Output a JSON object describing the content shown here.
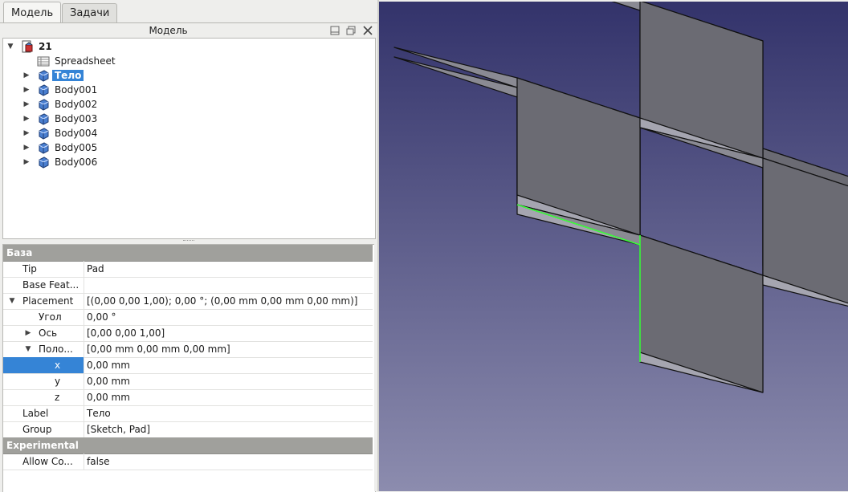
{
  "tabs": [
    {
      "label": "Модель",
      "active": true
    },
    {
      "label": "Задачи",
      "active": false
    }
  ],
  "tree_panel": {
    "title": "Модель",
    "items": [
      {
        "label": "21",
        "level": 0,
        "expanded": true,
        "icon": "document-icon",
        "bold": true
      },
      {
        "label": "Spreadsheet",
        "level": 1,
        "icon": "spreadsheet-icon"
      },
      {
        "label": "Тело",
        "level": 1,
        "icon": "body-icon",
        "selected": true,
        "collapsed": true
      },
      {
        "label": "Body001",
        "level": 1,
        "icon": "body-icon",
        "collapsed": true
      },
      {
        "label": "Body002",
        "level": 1,
        "icon": "body-icon",
        "collapsed": true
      },
      {
        "label": "Body003",
        "level": 1,
        "icon": "body-icon",
        "collapsed": true
      },
      {
        "label": "Body004",
        "level": 1,
        "icon": "body-icon",
        "collapsed": true
      },
      {
        "label": "Body005",
        "level": 1,
        "icon": "body-icon",
        "collapsed": true
      },
      {
        "label": "Body006",
        "level": 1,
        "icon": "body-icon",
        "collapsed": true
      }
    ]
  },
  "properties": {
    "rows": [
      {
        "type": "group",
        "name": "База"
      },
      {
        "type": "prop",
        "name": "Tip",
        "value": "Pad",
        "indent": 0
      },
      {
        "type": "prop",
        "name": "Base Feat...",
        "value": "",
        "indent": 0
      },
      {
        "type": "prop",
        "name": "Placement",
        "value": "[(0,00 0,00 1,00); 0,00 °; (0,00 mm  0,00 mm  0,00 mm)]",
        "indent": 0,
        "arrow": "down"
      },
      {
        "type": "prop",
        "name": "Угол",
        "value": "0,00 °",
        "indent": 1
      },
      {
        "type": "prop",
        "name": "Ось",
        "value": "[0,00 0,00 1,00]",
        "indent": 1,
        "arrow": "right"
      },
      {
        "type": "prop",
        "name": "Поло...",
        "value": "[0,00 mm  0,00 mm  0,00 mm]",
        "indent": 1,
        "arrow": "down"
      },
      {
        "type": "prop",
        "name": "x",
        "value": "0,00 mm",
        "indent": 2,
        "selected": true
      },
      {
        "type": "prop",
        "name": "y",
        "value": "0,00 mm",
        "indent": 2
      },
      {
        "type": "prop",
        "name": "z",
        "value": "0,00 mm",
        "indent": 2
      },
      {
        "type": "prop",
        "name": "Label",
        "value": "Тело",
        "indent": 0
      },
      {
        "type": "prop",
        "name": "Group",
        "value": "[Sketch, Pad]",
        "indent": 0
      },
      {
        "type": "group",
        "name": "Experimental"
      },
      {
        "type": "prop",
        "name": "Allow Co...",
        "value": "false",
        "indent": 0
      }
    ]
  },
  "view3d": {
    "background_top": "#33336b",
    "background_bottom": "#8c8cae",
    "face_top": "#8a8a93",
    "face_front": "#a5a5b0",
    "face_side": "#6b6b73",
    "edge_color": "#111111",
    "highlight_edge_color": "#3cff3c"
  }
}
